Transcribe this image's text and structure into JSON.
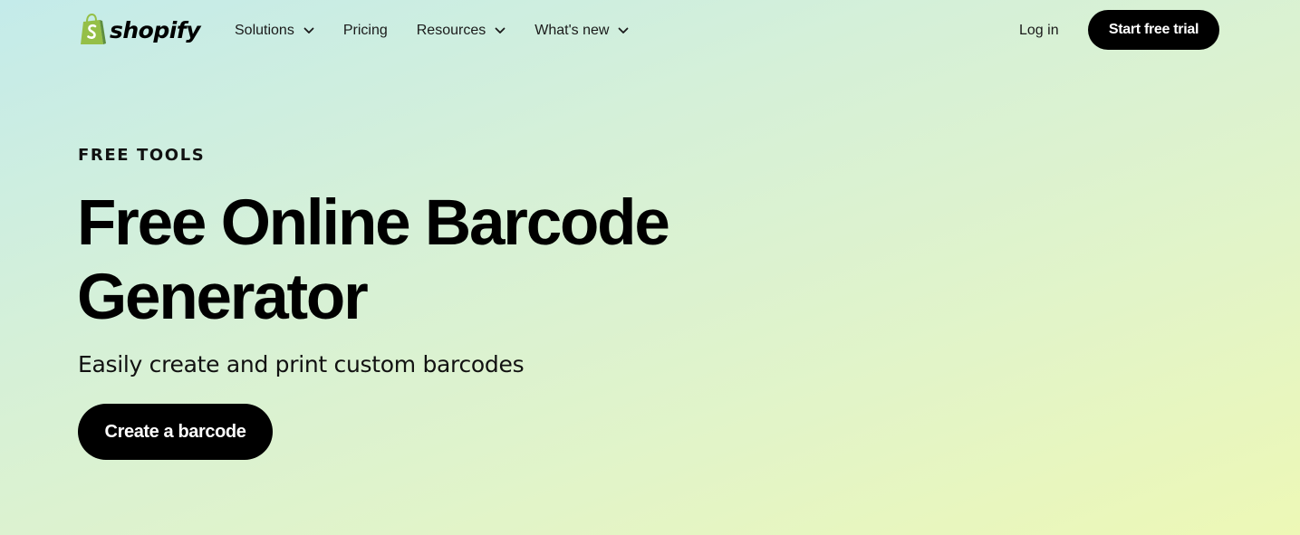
{
  "header": {
    "logo_text": "shopify",
    "logo_color": "#95bf47",
    "nav": [
      {
        "label": "Solutions",
        "has_dropdown": true
      },
      {
        "label": "Pricing",
        "has_dropdown": false
      },
      {
        "label": "Resources",
        "has_dropdown": true
      },
      {
        "label": "What's new",
        "has_dropdown": true
      }
    ],
    "login_label": "Log in",
    "trial_label": "Start free trial"
  },
  "hero": {
    "eyebrow": "FREE TOOLS",
    "title_line1": "Free Online Barcode",
    "title_line2": "Generator",
    "subtitle": "Easily create and print custom barcodes",
    "cta_label": "Create a barcode"
  },
  "colors": {
    "background_start": "#c4ebea",
    "background_end": "#edf8b6",
    "button": "#000000",
    "button_text": "#ffffff"
  },
  "icons": {
    "logo": "shopify-bag-icon",
    "dropdown": "chevron-down-icon"
  }
}
